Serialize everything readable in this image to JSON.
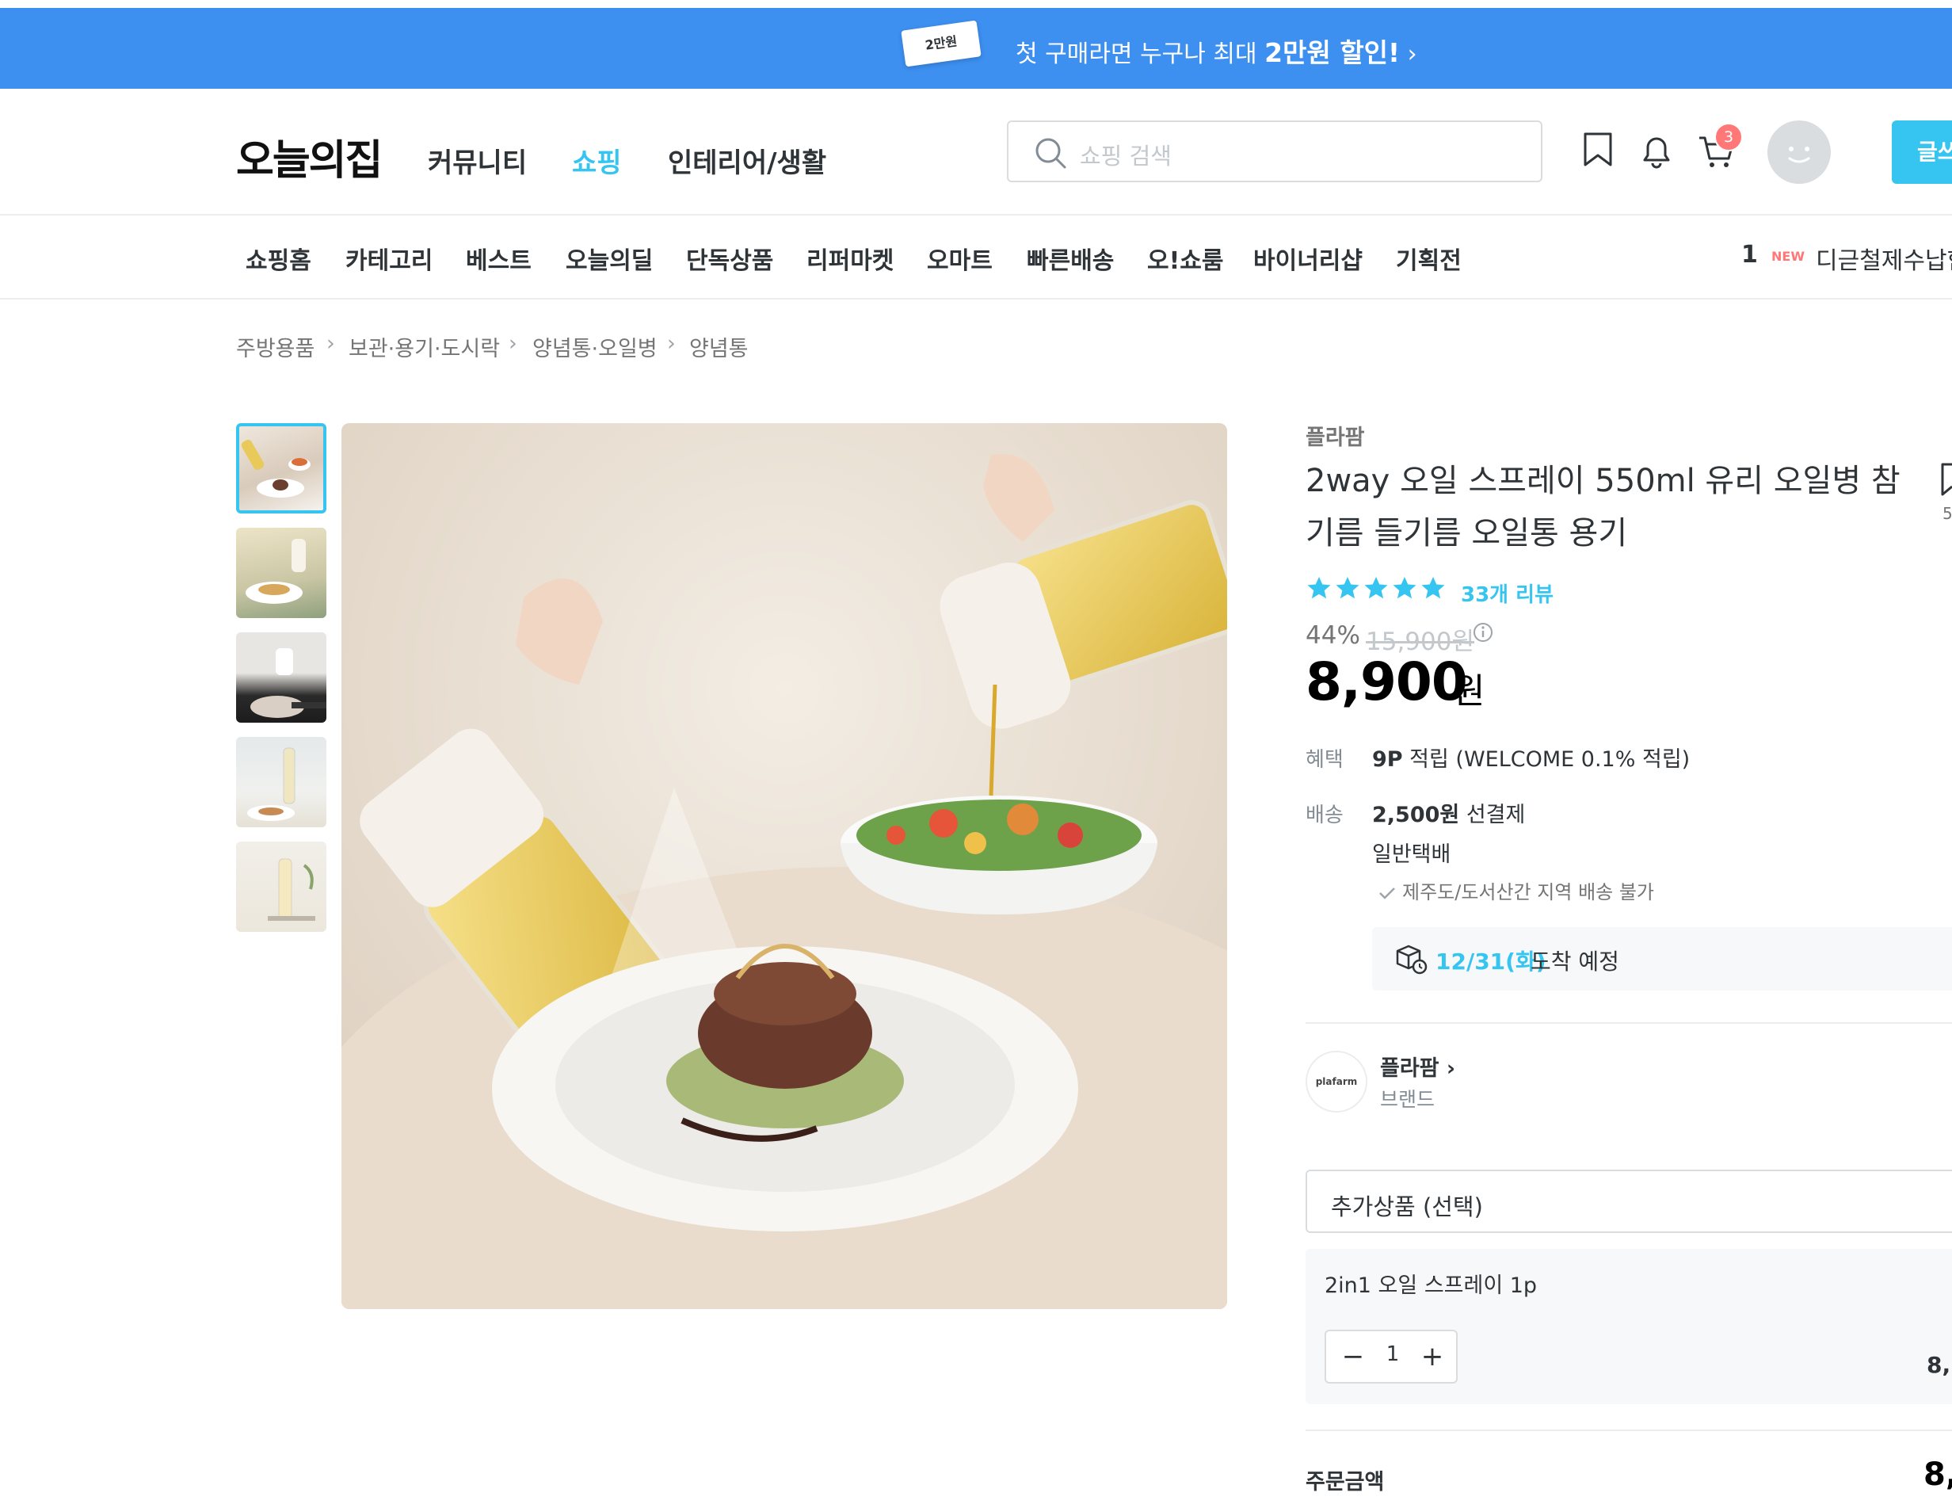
{
  "promo": {
    "ticket": "2만원",
    "text_pre": "첫 구매라면 누구나 최대 ",
    "text_bold": "2만원 할인!",
    "arrow": "›"
  },
  "header": {
    "logo": "오늘의집",
    "nav": [
      "커뮤니티",
      "쇼핑",
      "인테리어/생활"
    ],
    "active_nav": "쇼핑",
    "search_placeholder": "쇼핑 검색",
    "cart_count": "3",
    "write_label": "글쓰"
  },
  "shop_nav": {
    "items": [
      "쇼핑홈",
      "카테고리",
      "베스트",
      "오늘의딜",
      "단독상품",
      "리퍼마켓",
      "오마트",
      "빠른배송",
      "오!쇼룸",
      "바이너리샵",
      "기획전"
    ],
    "ranking_num": "1",
    "ranking_badge": "NEW",
    "ranking_text": "디귿철제수납함"
  },
  "breadcrumb": [
    "주방용품",
    "보관·용기·도시락",
    "양념통·오일병",
    "양념통"
  ],
  "product": {
    "brand": "플라팜",
    "title": "2way 오일 스프레이 550ml 유리 오일병 참기름 들기름 오일통 용기",
    "scrap_count": "5",
    "rating": 5,
    "review_count": "33개 리뷰",
    "discount": "44%",
    "original_price": "15,900원",
    "price": "8,900",
    "currency": "원",
    "benefit_label": "혜택",
    "benefit_points": "9P",
    "benefit_text": " 적립 (WELCOME 0.1% 적립)",
    "delivery_label": "배송",
    "delivery_fee": "2,500원",
    "delivery_fee_suffix": " 선결제",
    "delivery_type": "일반택배",
    "delivery_note": "제주도/도서산간 지역 배송 불가",
    "arrival_date": "12/31(화)",
    "arrival_text": "도착 예정"
  },
  "brand_card": {
    "logo_text": "plafarm",
    "name": "플라팜 ›",
    "type": "브랜드"
  },
  "option": {
    "select_placeholder": "추가상품 (선택)",
    "selected_name": "2in1 오일 스프레이 1p",
    "quantity": "1",
    "price": "8,"
  },
  "total": {
    "label": "주문금액",
    "value": "8,"
  },
  "colors": {
    "accent": "#35c5f0",
    "promo_bg": "#3d8ff0",
    "badge": "#ff7777"
  },
  "icons": [
    "search-icon",
    "bookmark-icon",
    "bell-icon",
    "cart-icon",
    "info-icon",
    "check-icon",
    "delivery-box-icon",
    "star-icon"
  ]
}
